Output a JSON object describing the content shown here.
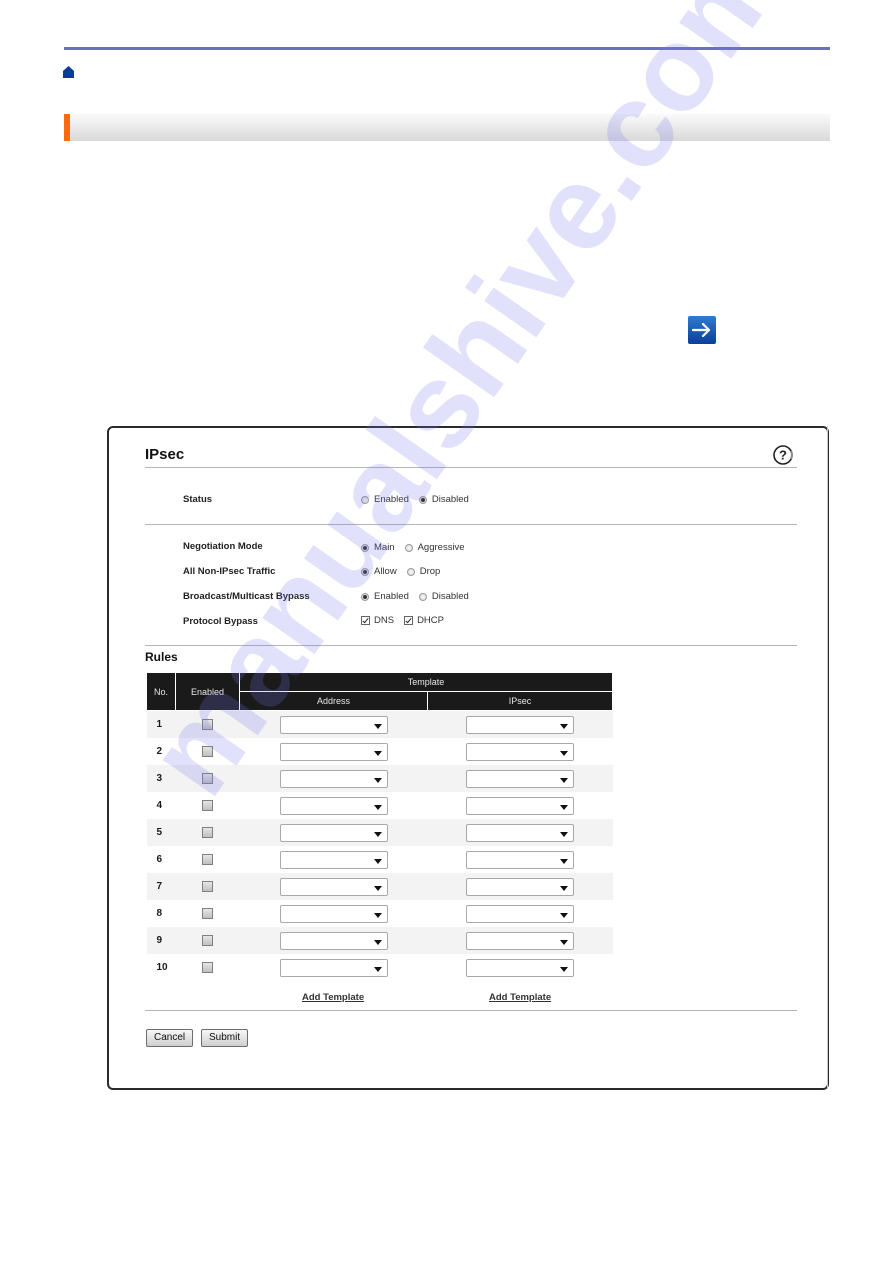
{
  "page": {
    "header_rule_color": "#6b6fc2",
    "section_accent_color": "#ff6a10",
    "home_icon": "home-icon",
    "next_icon": "arrow-right-icon"
  },
  "panel": {
    "title": "IPsec",
    "help_icon": "help-icon",
    "settings": {
      "status": {
        "label": "Status",
        "options": [
          {
            "label": "Enabled",
            "selected": false
          },
          {
            "label": "Disabled",
            "selected": true
          }
        ]
      },
      "negotiation_mode": {
        "label": "Negotiation Mode",
        "options": [
          {
            "label": "Main",
            "selected": true
          },
          {
            "label": "Aggressive",
            "selected": false
          }
        ]
      },
      "non_ipsec_traffic": {
        "label": "All Non-IPsec Traffic",
        "options": [
          {
            "label": "Allow",
            "selected": true
          },
          {
            "label": "Drop",
            "selected": false
          }
        ]
      },
      "broadcast_bypass": {
        "label": "Broadcast/Multicast Bypass",
        "options": [
          {
            "label": "Enabled",
            "selected": true
          },
          {
            "label": "Disabled",
            "selected": false
          }
        ]
      },
      "protocol_bypass": {
        "label": "Protocol Bypass",
        "options": [
          {
            "label": "DNS",
            "checked": true
          },
          {
            "label": "DHCP",
            "checked": true
          }
        ]
      }
    },
    "rules": {
      "title": "Rules",
      "headers": {
        "no": "No.",
        "enabled": "Enabled",
        "template": "Template",
        "address": "Address",
        "ipsec": "IPsec"
      },
      "rows": [
        {
          "no": "1",
          "enabled": false,
          "address": "",
          "ipsec": ""
        },
        {
          "no": "2",
          "enabled": false,
          "address": "",
          "ipsec": ""
        },
        {
          "no": "3",
          "enabled": false,
          "address": "",
          "ipsec": ""
        },
        {
          "no": "4",
          "enabled": false,
          "address": "",
          "ipsec": ""
        },
        {
          "no": "5",
          "enabled": false,
          "address": "",
          "ipsec": ""
        },
        {
          "no": "6",
          "enabled": false,
          "address": "",
          "ipsec": ""
        },
        {
          "no": "7",
          "enabled": false,
          "address": "",
          "ipsec": ""
        },
        {
          "no": "8",
          "enabled": false,
          "address": "",
          "ipsec": ""
        },
        {
          "no": "9",
          "enabled": false,
          "address": "",
          "ipsec": ""
        },
        {
          "no": "10",
          "enabled": false,
          "address": "",
          "ipsec": ""
        }
      ],
      "add_address_template": "Add Template",
      "add_ipsec_template": "Add Template"
    },
    "buttons": {
      "cancel": "Cancel",
      "submit": "Submit"
    }
  },
  "watermark": "manualshive.com"
}
